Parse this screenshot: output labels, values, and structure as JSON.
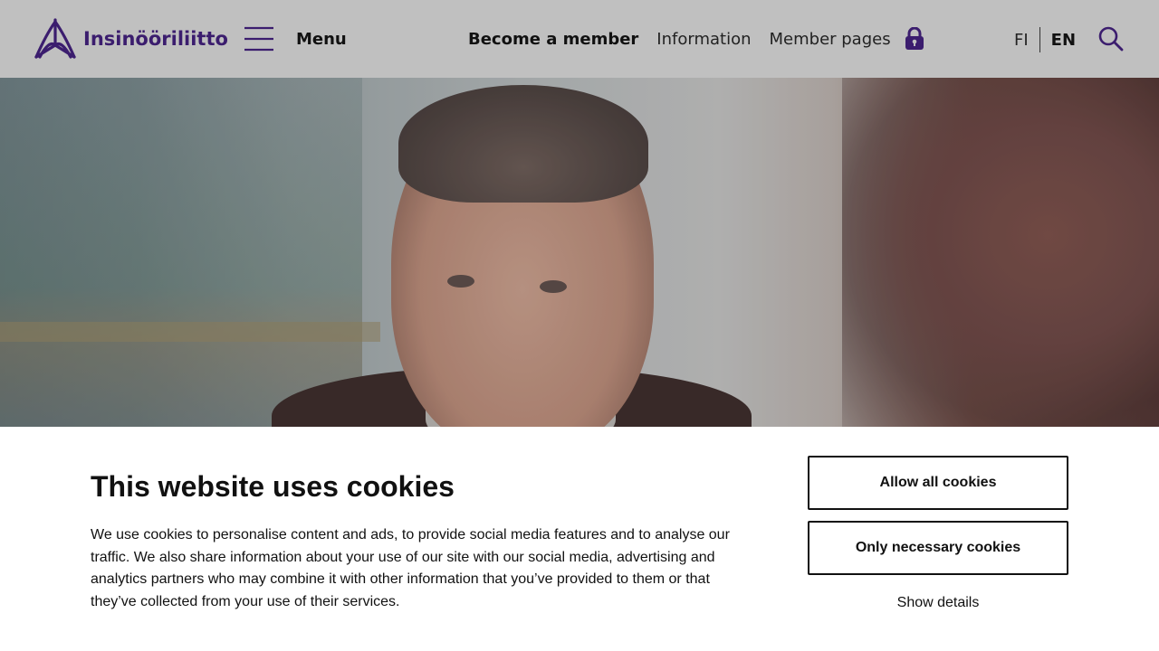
{
  "header": {
    "logo_text": "Insinööriliitto",
    "menu_label": "Menu",
    "nav": {
      "become_member": "Become a member",
      "information": "Information",
      "member_pages": "Member pages"
    },
    "lang": {
      "fi": "FI",
      "en": "EN",
      "active": "EN"
    },
    "icons": {
      "menu": "hamburger-icon",
      "lock": "lock-icon",
      "search": "search-icon"
    },
    "colors": {
      "brand": "#3b1d6e",
      "header_bg": "#c0c0c0"
    }
  },
  "cookie_banner": {
    "title": "This website uses cookies",
    "text": "We use cookies to personalise content and ads, to provide social media features and to analyse our traffic. We also share information about your use of our site with our social media, advertising and analytics partners who may combine it with other information that you’ve provided to them or that they’ve collected from your use of their services.",
    "allow_all": "Allow all cookies",
    "only_necessary": "Only necessary cookies",
    "show_details": "Show details"
  }
}
